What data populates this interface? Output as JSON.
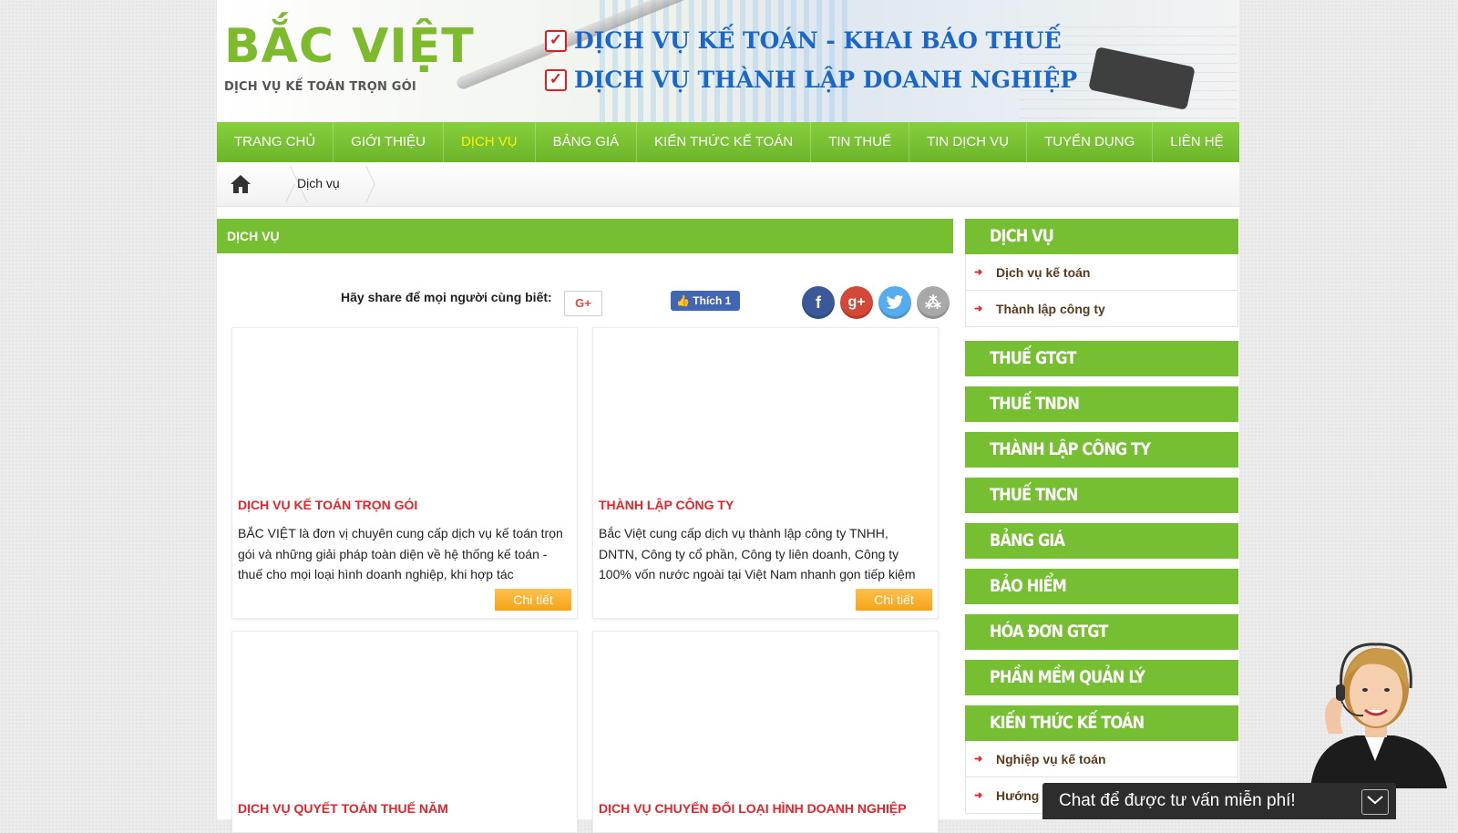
{
  "banner": {
    "logo_title": "BẮC VIỆT",
    "logo_sub": "DỊCH VỤ KẾ TOÁN TRỌN GÓI",
    "line1": "DỊCH VỤ KẾ TOÁN - KHAI BÁO THUẾ",
    "line2": "DỊCH VỤ THÀNH LẬP DOANH NGHIỆP"
  },
  "nav": {
    "items": [
      "TRANG CHỦ",
      "GIỚI THIỆU",
      "DỊCH VỤ",
      "BẢNG GIÁ",
      "KIẾN THỨC KẾ TOÁN",
      "TIN THUẾ",
      "TIN DỊCH VỤ",
      "TUYỂN DỤNG",
      "LIÊN HỆ"
    ],
    "active": "DỊCH VỤ"
  },
  "breadcrumb": {
    "current": "Dịch vụ"
  },
  "main": {
    "heading": "DỊCH VỤ",
    "share_text": "Hãy share để mọi người cùng biết:",
    "gplus_label": "G+",
    "like_label": "Thích",
    "like_count": "1",
    "cards": [
      {
        "title": "DỊCH VỤ KẾ TOÁN TRỌN GÓI",
        "desc": "BẮC VIỆT là đơn vị chuyên cung cấp dịch vụ kế toán trọn gói và những giải pháp toàn diện về hệ thống kế toán - thuế cho mọi loại hình doanh nghiệp, khi hợp tác",
        "button": "Chi tiết"
      },
      {
        "title": "THÀNH LẬP CÔNG TY",
        "desc": "Bắc Việt cung cấp dịch vụ thành lập công ty TNHH, DNTN, Công ty cổ phần, Công ty liên doanh, Công ty 100% vốn nước ngoài tại Việt Nam nhanh gọn tiếp kiệm",
        "button": "Chi tiết"
      },
      {
        "title": "DỊCH VỤ QUYẾT TOÁN THUẾ NĂM"
      },
      {
        "title": "DỊCH VỤ CHUYỂN ĐỔI LOẠI HÌNH DOANH NGHIỆP"
      }
    ]
  },
  "sidebar": {
    "dich_vu": {
      "heading": "DỊCH VỤ",
      "items": [
        "Dịch vụ kế toán",
        "Thành lập công ty"
      ]
    },
    "headings": [
      "THUẾ GTGT",
      "THUẾ TNDN",
      "THÀNH LẬP CÔNG TY",
      "THUẾ TNCN",
      "BẢNG GIÁ",
      "BẢO HIỂM",
      "HÓA ĐƠN GTGT",
      "PHẦN MỀM QUẢN LÝ"
    ],
    "kien_thuc": {
      "heading": "KIẾN THỨC KẾ TOÁN",
      "items": [
        "Nghiệp vụ kế toán",
        "Hướng"
      ]
    }
  },
  "chat": {
    "label": "Chat để được tư vấn miễn phí!"
  },
  "colors": {
    "green": "#76bf33",
    "red": "#e8232a",
    "orange": "#f5a319",
    "blue": "#1a66c9"
  },
  "icons": [
    "home-icon",
    "facebook-icon",
    "google-plus-icon",
    "twitter-icon",
    "share-icon",
    "check-icon",
    "arrow-right-icon",
    "chevron-down-icon"
  ]
}
